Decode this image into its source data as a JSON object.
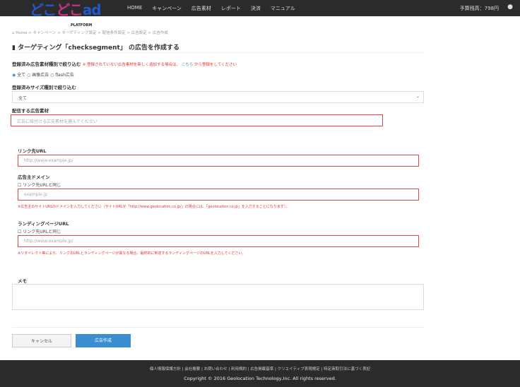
{
  "header": {
    "logo_text": "どこどこad",
    "logo_sub": "PLATFORM",
    "nav": [
      "HOME",
      "キャンペーン",
      "広告素材",
      "レポート",
      "決済",
      "マニュアル"
    ],
    "budget": "予算残高：798円"
  },
  "breadcrumb": "Home > キャンペーン > ターゲティング設定 > 配信条件設定 > 広告設定 > 広告作成",
  "page_title": "ターゲティング「checksegment」 の広告を作成する",
  "filter_type": {
    "label": "登録済み広告素材種別で絞り込む",
    "note_pre": "※ 登録されていない広告素材を新しく追加する場合は、",
    "note_link": "こちら",
    "note_post": "から登録をしてください",
    "options": [
      "全て",
      "画像広告",
      "flash広告"
    ]
  },
  "filter_size": {
    "label": "登録済みサイズ種別で絞り込む",
    "value": "全て"
  },
  "material": {
    "label": "配信する広告素材",
    "placeholder": "広告に紐付ける広告素材を選んでください"
  },
  "link_url": {
    "label": "リンク先URL",
    "placeholder": "http://www.example.jp/"
  },
  "domain": {
    "label": "広告主ドメイン",
    "checkbox": "リンク先URLと同じ",
    "placeholder": "example.jp",
    "hint": "※広告主のサイトURLのドメインを入力してください（サイトURLが「http://www.geolocation.co.jp/」の場合には、「geolocation.co.jp」を入力することになります）。"
  },
  "landing": {
    "label": "ランディングページURL",
    "checkbox": "リンク先URLと同じ",
    "placeholder": "http://www.example.jp/",
    "hint": "※リダイレクト等により、リンク先URLとランディングページが異なる場合、最終的に到達するランディングページのURLを入力してください。"
  },
  "memo": {
    "label": "メモ"
  },
  "buttons": {
    "cancel": "キャンセル",
    "create": "広告作成"
  },
  "footer": {
    "links": "個人情報保護方針 | 会社概要 | お問い合わせ | 利用規約 | 広告掲載基準 | クリエイティブ表現規定 | 特定商取引法に基づく表記",
    "copyright": "Copyright © 2016 Geolocation Technology,Inc. All rights reserved."
  }
}
